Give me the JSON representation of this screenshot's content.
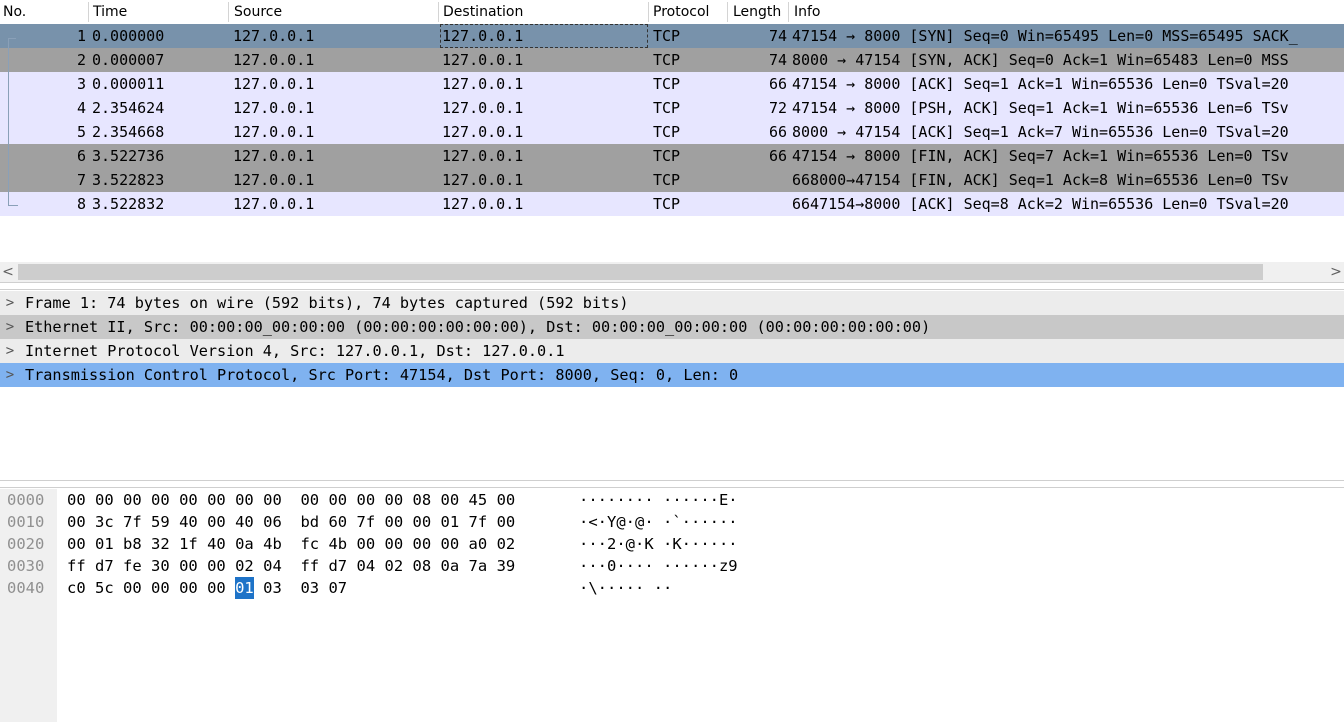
{
  "packet_list": {
    "columns": [
      "No.",
      "Time",
      "Source",
      "Destination",
      "Protocol",
      "Length",
      "Info"
    ],
    "rows": [
      {
        "no": "1",
        "time": "0.000000",
        "source": "127.0.0.1",
        "destination": "127.0.0.1",
        "protocol": "TCP",
        "length": "74",
        "info": "47154 → 8000 [SYN] Seq=0 Win=65495 Len=0 MSS=65495 SACK_",
        "style": "sel"
      },
      {
        "no": "2",
        "time": "0.000007",
        "source": "127.0.0.1",
        "destination": "127.0.0.1",
        "protocol": "TCP",
        "length": "74",
        "info": "8000 → 47154 [SYN, ACK] Seq=0 Ack=1 Win=65483 Len=0 MSS",
        "style": "gray"
      },
      {
        "no": "3",
        "time": "0.000011",
        "source": "127.0.0.1",
        "destination": "127.0.0.1",
        "protocol": "TCP",
        "length": "66",
        "info": "47154 → 8000 [ACK] Seq=1 Ack=1 Win=65536 Len=0 TSval=20",
        "style": "ack"
      },
      {
        "no": "4",
        "time": "2.354624",
        "source": "127.0.0.1",
        "destination": "127.0.0.1",
        "protocol": "TCP",
        "length": "72",
        "info": "47154 → 8000 [PSH, ACK] Seq=1 Ack=1 Win=65536 Len=6 TSv",
        "style": "ack"
      },
      {
        "no": "5",
        "time": "2.354668",
        "source": "127.0.0.1",
        "destination": "127.0.0.1",
        "protocol": "TCP",
        "length": "66",
        "info": "8000 → 47154 [ACK] Seq=1 Ack=7 Win=65536 Len=0 TSval=20",
        "style": "ack"
      },
      {
        "no": "6",
        "time": "3.522736",
        "source": "127.0.0.1",
        "destination": "127.0.0.1",
        "protocol": "TCP",
        "length": "66",
        "info": "47154 → 8000 [FIN, ACK] Seq=7 Ack=1 Win=65536 Len=0 TSv",
        "style": "gray"
      },
      {
        "no": "7",
        "time": "3.522823",
        "source": "127.0.0.1",
        "destination": "127.0.0.1",
        "protocol": "TCP",
        "length": "",
        "info": "668000→47154       [FIN, ACK] Seq=1 Ack=8 Win=65536 Len=0 TSv",
        "style": "gray"
      },
      {
        "no": "8",
        "time": "3.522832",
        "source": "127.0.0.1",
        "destination": "127.0.0.1",
        "protocol": "TCP",
        "length": "",
        "info": "6647154→8000       [ACK] Seq=8 Ack=2 Win=65536 Len=0 TSval=20",
        "style": "ack"
      }
    ]
  },
  "scrollbar": {
    "left_arrow": "<",
    "right_arrow": ">"
  },
  "details": [
    {
      "caret": ">",
      "text": "Frame 1: 74 bytes on wire (592 bits), 74 bytes captured (592 bits)",
      "style": "light"
    },
    {
      "caret": ">",
      "text": "Ethernet II, Src: 00:00:00_00:00:00 (00:00:00:00:00:00), Dst: 00:00:00_00:00:00 (00:00:00:00:00:00)",
      "style": "gray"
    },
    {
      "caret": ">",
      "text": "Internet Protocol Version 4, Src: 127.0.0.1, Dst: 127.0.0.1",
      "style": "light"
    },
    {
      "caret": ">",
      "text": "Transmission Control Protocol, Src Port: 47154, Dst Port: 8000, Seq: 0, Len: 0",
      "style": "sel"
    }
  ],
  "bytes": [
    {
      "offset": "0000",
      "hex": [
        "00",
        "00",
        "00",
        "00",
        "00",
        "00",
        "00",
        "00",
        "00",
        "00",
        "00",
        "00",
        "08",
        "00",
        "45",
        "00"
      ],
      "ascii": "········ ······E·"
    },
    {
      "offset": "0010",
      "hex": [
        "00",
        "3c",
        "7f",
        "59",
        "40",
        "00",
        "40",
        "06",
        "bd",
        "60",
        "7f",
        "00",
        "00",
        "01",
        "7f",
        "00"
      ],
      "ascii": "·<·Y@·@· ·`······"
    },
    {
      "offset": "0020",
      "hex": [
        "00",
        "01",
        "b8",
        "32",
        "1f",
        "40",
        "0a",
        "4b",
        "fc",
        "4b",
        "00",
        "00",
        "00",
        "00",
        "a0",
        "02"
      ],
      "ascii": "···2·@·K ·K······"
    },
    {
      "offset": "0030",
      "hex": [
        "ff",
        "d7",
        "fe",
        "30",
        "00",
        "00",
        "02",
        "04",
        "ff",
        "d7",
        "04",
        "02",
        "08",
        "0a",
        "7a",
        "39"
      ],
      "ascii": "···0···· ······z9"
    },
    {
      "offset": "0040",
      "hex": [
        "c0",
        "5c",
        "00",
        "00",
        "00",
        "00",
        "01",
        "03",
        "03",
        "07"
      ],
      "ascii": "·\\····· ··",
      "highlight_index": 6
    }
  ]
}
